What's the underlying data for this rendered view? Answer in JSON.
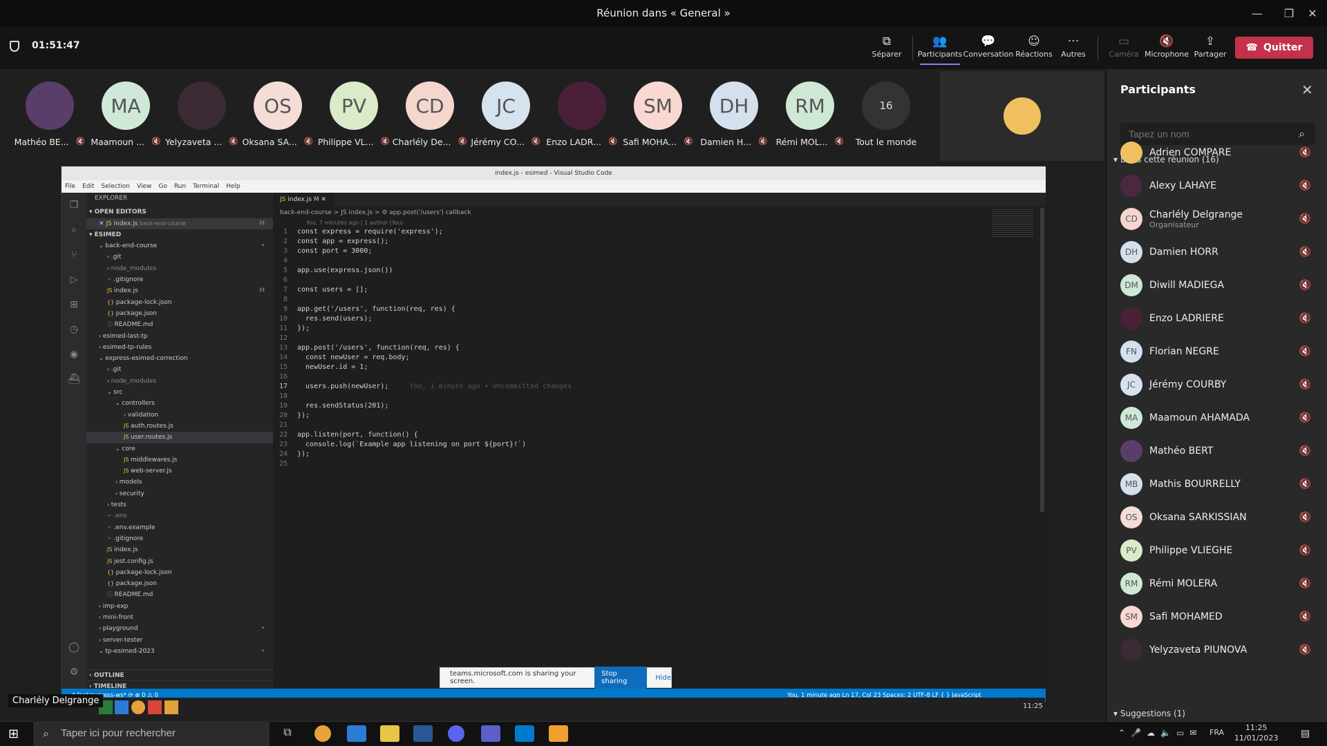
{
  "window": {
    "title": "Réunion dans « General »"
  },
  "meeting": {
    "timer": "01:51:47"
  },
  "toolbar": {
    "separate": "Séparer",
    "participants": "Participants",
    "chat": "Conversation",
    "reactions": "Réactions",
    "more": "Autres",
    "camera": "Caméra",
    "mic": "Microphone",
    "share": "Partager",
    "quit": "Quitter"
  },
  "strip": [
    {
      "initials": "",
      "name": "Mathéo BE...",
      "color": "#5a3e6a"
    },
    {
      "initials": "MA",
      "name": "Maamoun ...",
      "color": "#cfe8d8"
    },
    {
      "initials": "",
      "name": "Yelyzaveta ...",
      "color": "#3a2b35"
    },
    {
      "initials": "OS",
      "name": "Oksana SA...",
      "color": "#f3ddd6"
    },
    {
      "initials": "PV",
      "name": "Philippe VL...",
      "color": "#dbeac8"
    },
    {
      "initials": "CD",
      "name": "Charlély De...",
      "color": "#f5d6cc"
    },
    {
      "initials": "JC",
      "name": "Jérémy CO...",
      "color": "#d6e2ee"
    },
    {
      "initials": "",
      "name": "Enzo LADR...",
      "color": "#4a2038"
    },
    {
      "initials": "SM",
      "name": "Safi MOHA...",
      "color": "#f8d8d0"
    },
    {
      "initials": "DH",
      "name": "Damien H...",
      "color": "#d4e0ee"
    },
    {
      "initials": "RM",
      "name": "Rémi MOL...",
      "color": "#cfe8d6"
    },
    {
      "initials": "16",
      "name": "Tout le monde",
      "color": "#333333"
    }
  ],
  "vscode": {
    "title": "index.js - esimed - Visual Studio Code",
    "menu": [
      "File",
      "Edit",
      "Selection",
      "View",
      "Go",
      "Run",
      "Terminal",
      "Help"
    ],
    "explorer_title": "EXPLORER",
    "open_editors": "OPEN EDITORS",
    "open_file": "index.js",
    "open_file_path": "back-end-course",
    "root": "ESIMED",
    "tree": [
      {
        "label": "back-end-course",
        "indent": 1,
        "kind": "folder-open",
        "mark": "•"
      },
      {
        "label": ".git",
        "indent": 2,
        "kind": "folder"
      },
      {
        "label": "node_modules",
        "indent": 2,
        "kind": "folder",
        "dim": true
      },
      {
        "label": ".gitignore",
        "indent": 2,
        "kind": "file"
      },
      {
        "label": "index.js",
        "indent": 2,
        "kind": "js",
        "mark": "M"
      },
      {
        "label": "package-lock.json",
        "indent": 2,
        "kind": "json"
      },
      {
        "label": "package.json",
        "indent": 2,
        "kind": "json"
      },
      {
        "label": "README.md",
        "indent": 2,
        "kind": "md"
      },
      {
        "label": "esimed-last-tp",
        "indent": 1,
        "kind": "folder"
      },
      {
        "label": "esimed-tp-rules",
        "indent": 1,
        "kind": "folder"
      },
      {
        "label": "express-esimed-correction",
        "indent": 1,
        "kind": "folder-open"
      },
      {
        "label": ".git",
        "indent": 2,
        "kind": "folder"
      },
      {
        "label": "node_modules",
        "indent": 2,
        "kind": "folder",
        "dim": true
      },
      {
        "label": "src",
        "indent": 2,
        "kind": "folder-open"
      },
      {
        "label": "controllers",
        "indent": 3,
        "kind": "folder-open"
      },
      {
        "label": "validation",
        "indent": 4,
        "kind": "folder"
      },
      {
        "label": "auth.routes.js",
        "indent": 4,
        "kind": "js"
      },
      {
        "label": "user.routes.js",
        "indent": 4,
        "kind": "js",
        "selected": true
      },
      {
        "label": "core",
        "indent": 3,
        "kind": "folder-open"
      },
      {
        "label": "middlewares.js",
        "indent": 4,
        "kind": "js"
      },
      {
        "label": "web-server.js",
        "indent": 4,
        "kind": "js"
      },
      {
        "label": "models",
        "indent": 3,
        "kind": "folder"
      },
      {
        "label": "security",
        "indent": 3,
        "kind": "folder"
      },
      {
        "label": "tests",
        "indent": 2,
        "kind": "folder"
      },
      {
        "label": ".env",
        "indent": 2,
        "kind": "file",
        "dim": true
      },
      {
        "label": ".env.example",
        "indent": 2,
        "kind": "file"
      },
      {
        "label": ".gitignore",
        "indent": 2,
        "kind": "file"
      },
      {
        "label": "index.js",
        "indent": 2,
        "kind": "js"
      },
      {
        "label": "jest.config.js",
        "indent": 2,
        "kind": "js"
      },
      {
        "label": "package-lock.json",
        "indent": 2,
        "kind": "json"
      },
      {
        "label": "package.json",
        "indent": 2,
        "kind": "json"
      },
      {
        "label": "README.md",
        "indent": 2,
        "kind": "md"
      },
      {
        "label": "imp-exp",
        "indent": 1,
        "kind": "folder"
      },
      {
        "label": "mini-front",
        "indent": 1,
        "kind": "folder"
      },
      {
        "label": "playground",
        "indent": 1,
        "kind": "folder",
        "mark": "•"
      },
      {
        "label": "server-tester",
        "indent": 1,
        "kind": "folder"
      },
      {
        "label": "tp-esimed-2023",
        "indent": 1,
        "kind": "folder-open",
        "mark": "•"
      }
    ],
    "outline": "OUTLINE",
    "timeline": "TIMELINE",
    "tab": "index.js",
    "tab_mark": "M",
    "breadcrumb": "back-end-course  >  JS index.js  >  ⚙ app.post('/users') callback",
    "blame": "You, 7 minutes ago | 1 author (You)",
    "code": [
      "const express = require('express');",
      "const app = express();",
      "const port = 3000;",
      "",
      "app.use(express.json())",
      "",
      "const users = [];",
      "",
      "app.get('/users', function(req, res) {",
      "  res.send(users);",
      "});",
      "",
      "app.post('/users', function(req, res) {",
      "  const newUser = req.body;",
      "  newUser.id = 1;",
      "",
      "  users.push(newUser);",
      "",
      "  res.sendStatus(201);",
      "});",
      "",
      "app.listen(port, function() {",
      "  console.log(`Example app listening on port ${port}!`)",
      "});",
      ""
    ],
    "inline_hint": "You, 1 minute ago • Uncommitted changes",
    "status_left": "⎇ feat/express-ws*   ⟳   ⊗ 0 ⚠ 0",
    "status_right": "You, 1 minute ago    Ln 17, Col 23    Spaces: 2    UTF-8    LF    { } JavaScript",
    "share_banner": {
      "text": "teams.microsoft.com is sharing your screen.",
      "stop": "Stop sharing",
      "hide": "Hide"
    },
    "inner_clock": "11:25"
  },
  "tooltip": "Charlély Delgrange",
  "panel": {
    "title": "Participants",
    "search_placeholder": "Tapez un nom",
    "in_meeting": "Dans cette réunion (16)",
    "suggestions": "Suggestions (1)",
    "people": [
      {
        "initials": "",
        "name": "Adrien COMPARE",
        "color": "#f0c060"
      },
      {
        "initials": "",
        "name": "Alexy LAHAYE",
        "color": "#4a2840"
      },
      {
        "initials": "CD",
        "name": "Charlély Delgrange",
        "sub": "Organisateur",
        "color": "#f5d6cc"
      },
      {
        "initials": "DH",
        "name": "Damien HORR",
        "color": "#d4e0ee"
      },
      {
        "initials": "DM",
        "name": "Diwill MADIEGA",
        "color": "#cfe8d6"
      },
      {
        "initials": "",
        "name": "Enzo LADRIERE",
        "color": "#4a2038"
      },
      {
        "initials": "FN",
        "name": "Florian NEGRE",
        "color": "#d4e0ee"
      },
      {
        "initials": "JC",
        "name": "Jérémy COURBY",
        "color": "#d6e2ee"
      },
      {
        "initials": "MA",
        "name": "Maamoun AHAMADA",
        "color": "#cfe8d8"
      },
      {
        "initials": "",
        "name": "Mathéo BERT",
        "color": "#5a3e6a"
      },
      {
        "initials": "MB",
        "name": "Mathis BOURRELLY",
        "color": "#d4e0ee"
      },
      {
        "initials": "OS",
        "name": "Oksana SARKISSIAN",
        "color": "#f3ddd6"
      },
      {
        "initials": "PV",
        "name": "Philippe VLIEGHE",
        "color": "#dbeac8"
      },
      {
        "initials": "RM",
        "name": "Rémi MOLERA",
        "color": "#cfe8d6"
      },
      {
        "initials": "SM",
        "name": "Safi MOHAMED",
        "color": "#f8d8d0"
      },
      {
        "initials": "",
        "name": "Yelyzaveta PIUNOVA",
        "color": "#3a2b35"
      }
    ]
  },
  "taskbar": {
    "search_placeholder": "Taper ici pour rechercher",
    "lang": "FRA",
    "time": "11:25",
    "date": "11/01/2023"
  }
}
